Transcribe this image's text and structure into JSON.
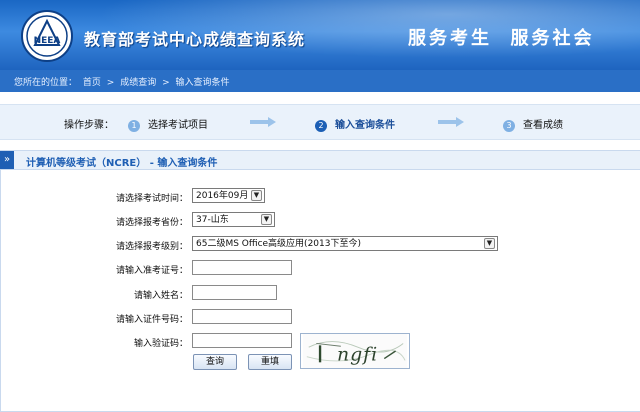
{
  "header": {
    "title": "教育部考试中心成绩查询系统",
    "slogan": "服务考生  服务社会",
    "logo_text": "NEEA"
  },
  "breadcrumb": {
    "prefix": "您所在的位置：",
    "items": [
      "首页",
      "成绩查询",
      "输入查询条件"
    ],
    "separator": ">"
  },
  "steps": {
    "label": "操作步骤：",
    "items": [
      {
        "num": "1",
        "label": "选择考试项目"
      },
      {
        "num": "2",
        "label": "输入查询条件"
      },
      {
        "num": "3",
        "label": "查看成绩"
      }
    ]
  },
  "section": {
    "title": "计算机等级考试（NCRE） - 输入查询条件"
  },
  "form": {
    "exam_time": {
      "label": "请选择考试时间：",
      "value": "2016年09月"
    },
    "province": {
      "label": "请选择报考省份：",
      "value": "37-山东"
    },
    "level": {
      "label": "请选择报考级别：",
      "value": "65二级MS Office高级应用(2013下至今)"
    },
    "ticket": {
      "label": "请输入准考证号：",
      "value": ""
    },
    "name": {
      "label": "请输入姓名：",
      "value": ""
    },
    "id_number": {
      "label": "请输入证件号码：",
      "value": ""
    },
    "captcha": {
      "label": "输入验证码：",
      "value": "",
      "image_text": "ngfi"
    },
    "query_button": "查询",
    "reset_button": "重填"
  },
  "colors": {
    "header_blue": "#1a67c4",
    "accent": "#1f5fb4"
  }
}
